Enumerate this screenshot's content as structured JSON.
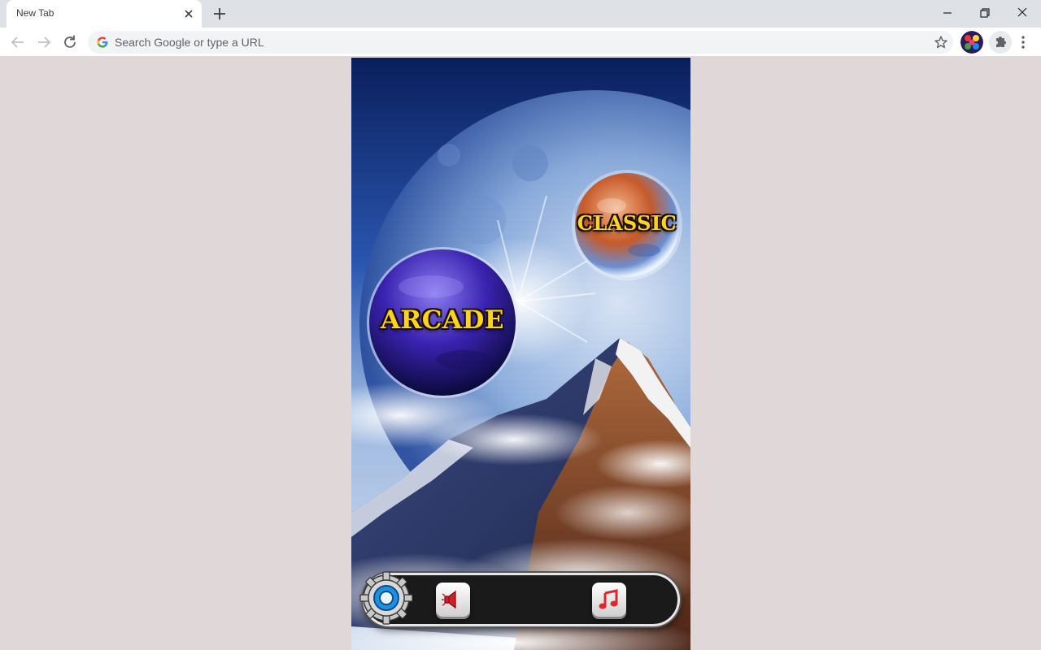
{
  "browser": {
    "tab": {
      "title": "New Tab"
    },
    "omnibox": {
      "placeholder": "Search Google or type a URL"
    },
    "icons": [
      "back-icon",
      "forward-icon",
      "reload-icon",
      "google-icon",
      "star-icon",
      "avatar",
      "extensions-icon",
      "menu-icon"
    ]
  },
  "game": {
    "modes": {
      "classic": "CLASSIC",
      "arcade": "ARCADE"
    },
    "controls": [
      "settings-gear-icon",
      "sound-icon",
      "music-note-icon"
    ],
    "colors": {
      "label": "#ffd21f",
      "bar": "#1a1a1a",
      "music_note": "#e0262c"
    }
  }
}
